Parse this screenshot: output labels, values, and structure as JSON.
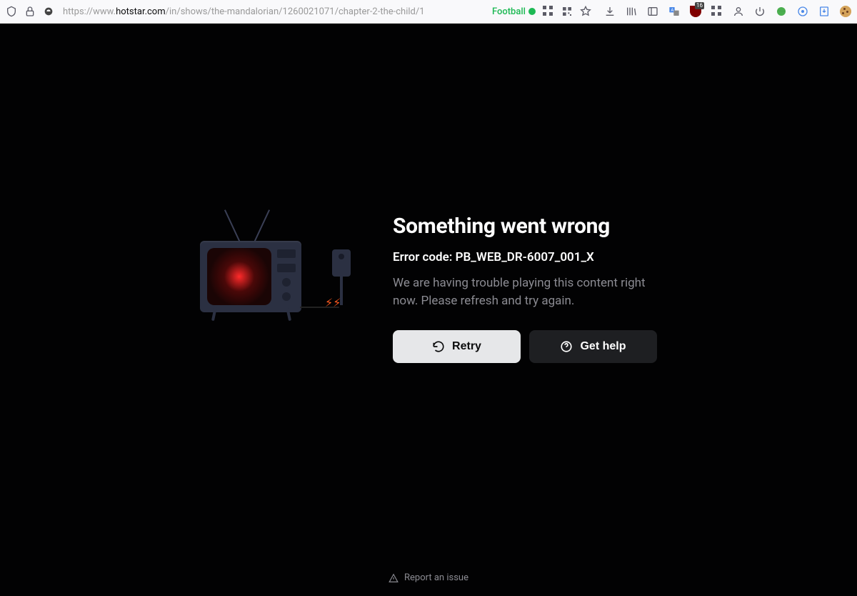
{
  "browser": {
    "url_prefix": "https://www.",
    "url_domain": "hotstar.com",
    "url_path": "/in/shows/the-mandalorian/1260021071/chapter-2-the-child/1",
    "tag_label": "Football",
    "ublock_count": "16"
  },
  "error": {
    "title": "Something went wrong",
    "code_label": "Error code: PB_WEB_DR-6007_001_X",
    "message": "We are having trouble playing this content right now. Please refresh and try again.",
    "retry_label": "Retry",
    "help_label": "Get help",
    "report_label": "Report an issue"
  }
}
